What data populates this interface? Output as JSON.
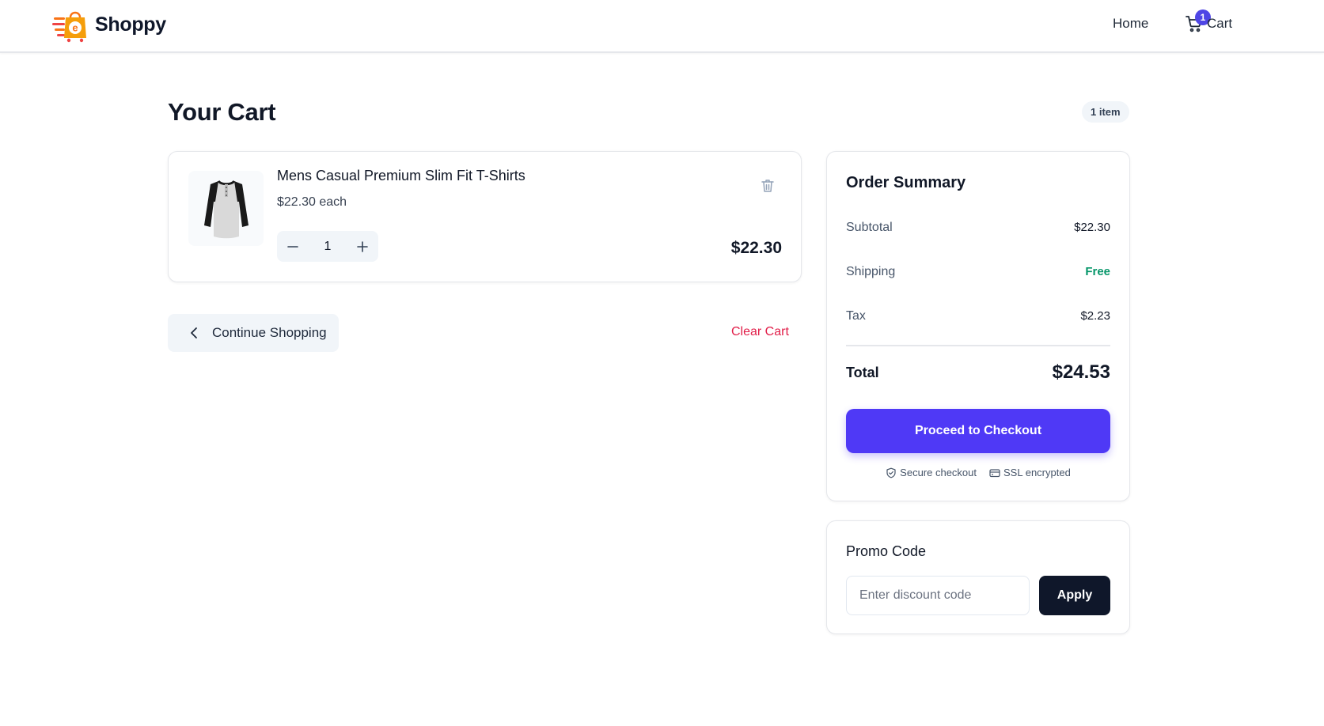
{
  "brand": {
    "name": "Shoppy",
    "logo": "shopping-bag-logo"
  },
  "nav": {
    "home_label": "Home",
    "cart_label": "Cart",
    "cart_count": "1"
  },
  "page": {
    "title": "Your Cart",
    "item_count": "1 item"
  },
  "items": [
    {
      "name": "Mens Casual Premium Slim Fit T-Shirts",
      "unit_price": "$22.30 each",
      "quantity": "1",
      "line_total": "$22.30",
      "image": "t-shirt-image"
    }
  ],
  "actions": {
    "continue_label": "Continue Shopping",
    "clear_label": "Clear Cart"
  },
  "summary": {
    "title": "Order Summary",
    "subtotal_label": "Subtotal",
    "subtotal": "$22.30",
    "shipping_label": "Shipping",
    "shipping": "Free",
    "tax_label": "Tax",
    "tax": "$2.23",
    "total_label": "Total",
    "total": "$24.53",
    "checkout_label": "Proceed to Checkout",
    "secure_label": "Secure checkout",
    "ssl_label": "SSL encrypted"
  },
  "promo": {
    "title": "Promo Code",
    "placeholder": "Enter discount code",
    "value": "",
    "apply_label": "Apply"
  },
  "colors": {
    "accent": "#4f39f6",
    "danger": "#e11d48",
    "success": "#059669",
    "dark": "#0f172a"
  }
}
